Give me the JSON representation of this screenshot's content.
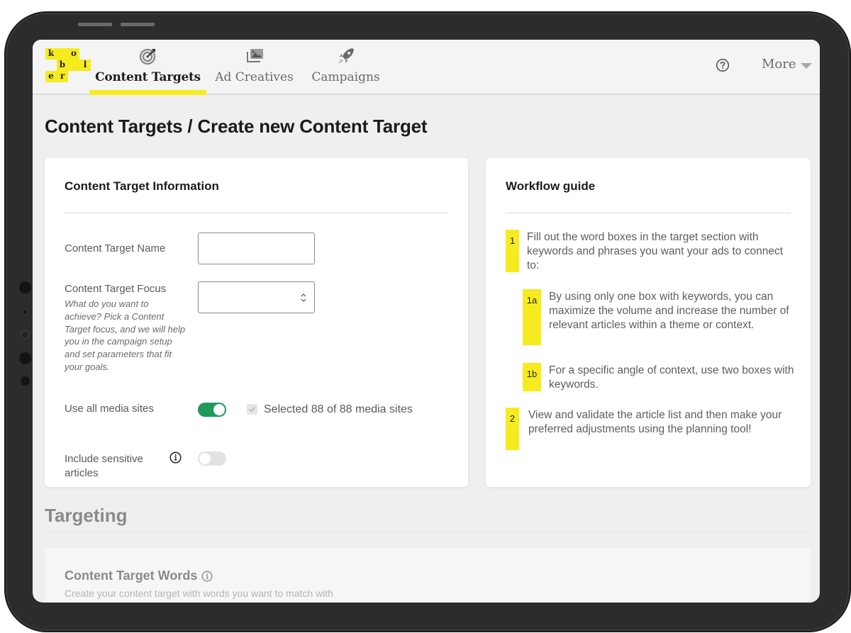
{
  "app": {
    "logo_letters": [
      "k",
      "o",
      "b",
      "l",
      "e",
      "r"
    ],
    "brand_color": "#f5eb1f",
    "accent_green": "#1e9a5a"
  },
  "nav": {
    "items": [
      {
        "label": "Content Targets",
        "icon": "target-icon",
        "active": true
      },
      {
        "label": "Ad Creatives",
        "icon": "image-gallery-icon",
        "active": false
      },
      {
        "label": "Campaigns",
        "icon": "rocket-icon",
        "active": false
      }
    ],
    "help_icon": "help-circle-icon",
    "more_label": "More"
  },
  "page": {
    "title": "Content Targets / Create new Content Target"
  },
  "info_card": {
    "title": "Content Target Information",
    "name_label": "Content Target Name",
    "name_value": "",
    "focus_label": "Content Target Focus",
    "focus_help": "What do you want to achieve? Pick a Content Target focus, and we will help you in the campaign setup and set parameters that fit your goals.",
    "focus_value": "",
    "media_label": "Use all media sites",
    "media_toggle_on": true,
    "media_checkbox_checked": true,
    "media_selected_text": "Selected 88 of 88 media sites",
    "sensitive_label": "Include sensitive articles",
    "sensitive_toggle_on": false
  },
  "guide_card": {
    "title": "Workflow guide",
    "steps": [
      {
        "badge": "1",
        "text": "Fill out the word boxes in the target section with keywords and phrases you want your ads to connect to:"
      },
      {
        "badge": "1a",
        "text": "By using only one box with keywords, you can maximize the volume and increase the number of relevant articles within a theme or context."
      },
      {
        "badge": "1b",
        "text": "For a specific angle of context, use two boxes with keywords."
      },
      {
        "badge": "2",
        "text": "View and validate the article list and then make your preferred adjustments using the planning tool!"
      }
    ]
  },
  "targeting": {
    "section_title": "Targeting",
    "words_title": "Content Target Words",
    "words_subtitle": "Create your content target with words you want to match with"
  }
}
